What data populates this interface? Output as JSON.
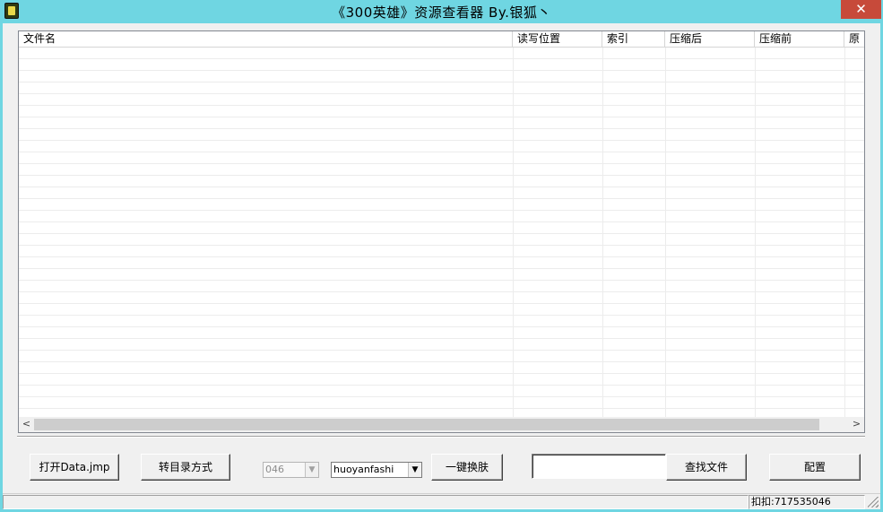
{
  "window": {
    "title": "《300英雄》资源查看器      By.银狐丶",
    "close_glyph": "✕"
  },
  "list": {
    "columns": [
      "文件名",
      "读写位置",
      "索引",
      "压缩后",
      "压缩前",
      "原"
    ]
  },
  "scrollbar": {
    "left_glyph": "<",
    "right_glyph": ">"
  },
  "buttons": {
    "open_data": "打开Data.jmp",
    "dir_mode": "转目录方式",
    "one_key_skin": "一键换肤",
    "find_file": "查找文件",
    "config": "配置"
  },
  "combos": {
    "number": {
      "value": "046",
      "disabled": true
    },
    "hero": {
      "value": "huoyanfashi"
    }
  },
  "search": {
    "value": ""
  },
  "status": {
    "pane1": "",
    "pane2": "扣扣:717535046"
  }
}
